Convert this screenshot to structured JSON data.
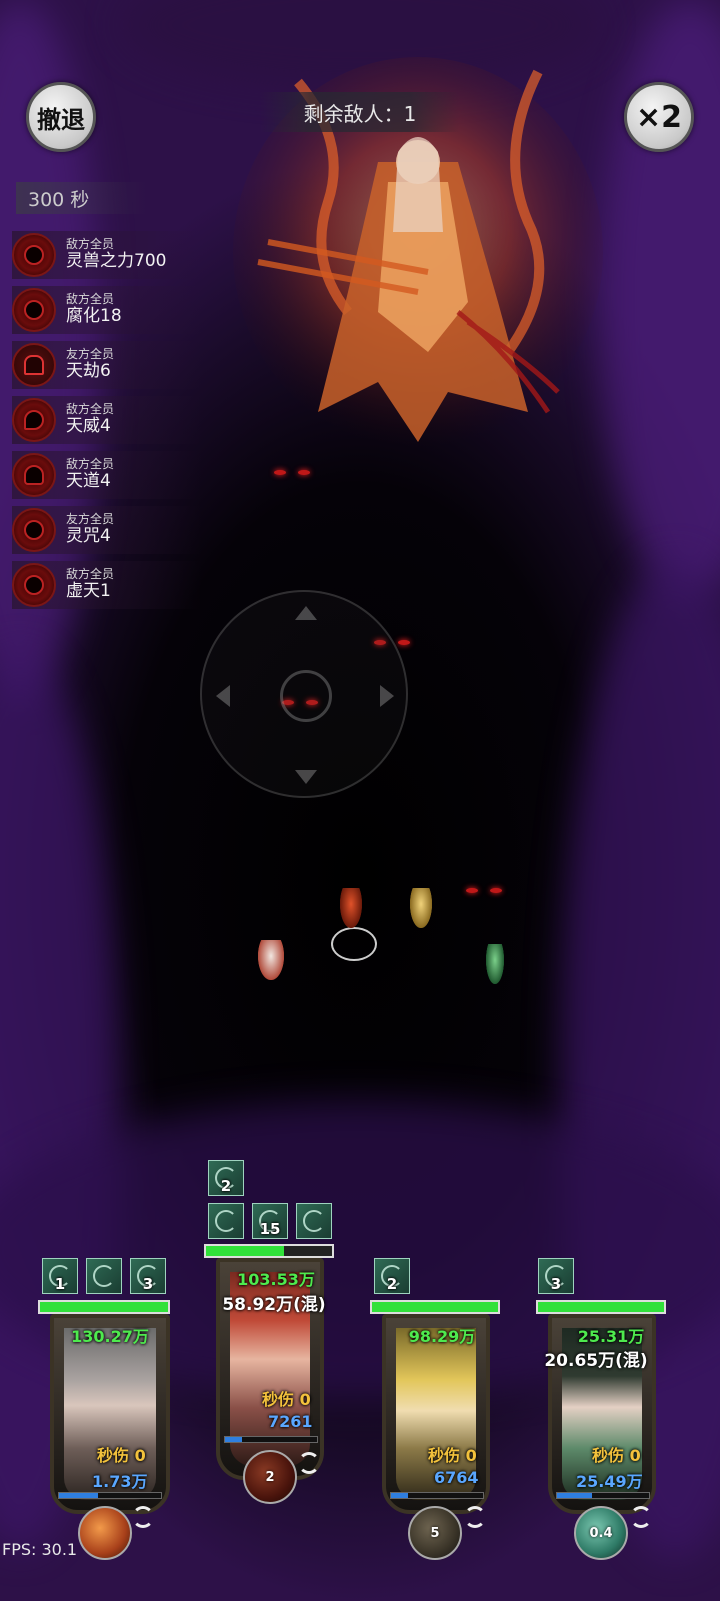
{
  "hud": {
    "retreat_label": "撤退",
    "speed_label": "×2",
    "enemies_remaining": "剩余敌人：1",
    "timer": "300 秒",
    "fps": "FPS: 30.1"
  },
  "buffs": [
    {
      "scope": "敌方全员",
      "name": "灵兽之力700",
      "icon": "demon-mask-icon"
    },
    {
      "scope": "敌方全员",
      "name": "腐化18",
      "icon": "demon-mask-icon"
    },
    {
      "scope": "友方全员",
      "name": "天劫6",
      "icon": "storm-cloud-icon"
    },
    {
      "scope": "敌方全员",
      "name": "天威4",
      "icon": "dragon-icon"
    },
    {
      "scope": "敌方全员",
      "name": "天道4",
      "icon": "flame-demon-icon"
    },
    {
      "scope": "友方全员",
      "name": "灵咒4",
      "icon": "demon-mask-icon"
    },
    {
      "scope": "敌方全员",
      "name": "虚天1",
      "icon": "demon-mask-icon"
    }
  ],
  "heroes": [
    {
      "skills": [
        {
          "count": "1",
          "icon": "figure-icon"
        },
        {
          "count": "",
          "icon": "leaf-icon"
        },
        {
          "count": "3",
          "icon": "rooster-icon"
        }
      ],
      "hp_fraction": 1.0,
      "hp_value": "130.27万",
      "mix_value": "",
      "dps": "秒伤 0",
      "mana_fraction": 0.38,
      "mana_value": "1.73万",
      "orb_label": "",
      "orb_color": "#c0622a"
    },
    {
      "skills_top": [
        {
          "count": "2",
          "icon": "rooster-icon"
        }
      ],
      "skills": [
        {
          "count": "",
          "icon": "spirit-icon"
        },
        {
          "count": "15",
          "icon": "spirit-icon"
        },
        {
          "count": "",
          "icon": "leaf-icon"
        }
      ],
      "hp_fraction": 0.62,
      "hp_value": "103.53万",
      "mix_value": "58.92万(混)",
      "dps": "秒伤 0",
      "mana_fraction": 0.18,
      "mana_value": "7261",
      "orb_label": "2",
      "orb_color": "#6a2818"
    },
    {
      "skills": [
        {
          "count": "2",
          "icon": "rooster-icon"
        }
      ],
      "hp_fraction": 1.0,
      "hp_value": "98.29万",
      "mix_value": "",
      "dps": "秒伤 0",
      "mana_fraction": 0.18,
      "mana_value": "6764",
      "orb_label": "5",
      "orb_color": "#4a4236"
    },
    {
      "skills": [
        {
          "count": "3",
          "icon": "rooster-icon"
        }
      ],
      "hp_fraction": 1.0,
      "hp_value": "25.31万",
      "mix_value": "20.65万(混)",
      "dps": "秒伤 0",
      "mana_fraction": 0.38,
      "mana_value": "25.49万",
      "orb_label": "0.4",
      "orb_color": "#2e7a66"
    }
  ],
  "colors": {
    "hp": "#31e13a",
    "mana": "#2f7fe0",
    "dps": "#f3c23c",
    "skill_tile": "#2f6b55"
  }
}
